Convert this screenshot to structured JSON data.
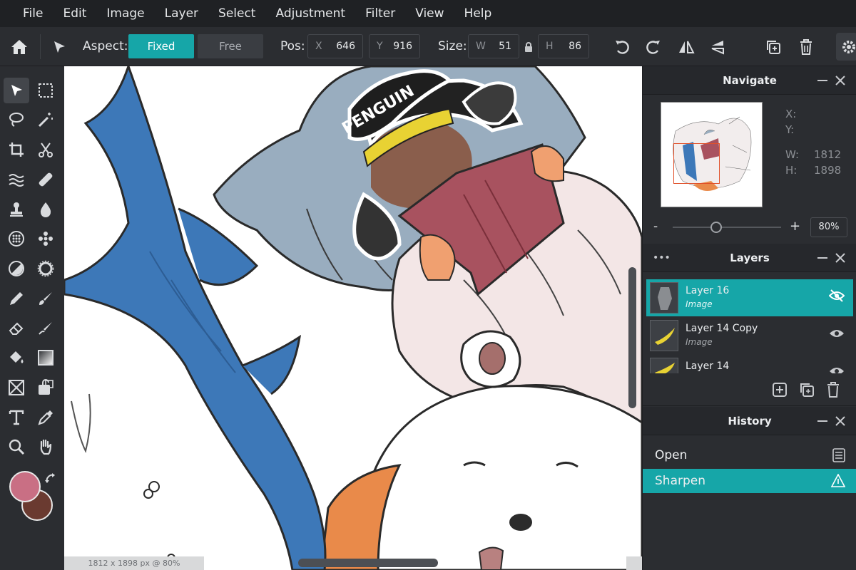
{
  "menu": [
    "File",
    "Edit",
    "Image",
    "Layer",
    "Select",
    "Adjustment",
    "Filter",
    "View",
    "Help"
  ],
  "toolbar": {
    "aspect_label": "Aspect:",
    "fixed_label": "Fixed",
    "free_label": "Free",
    "pos_label": "Pos:",
    "pos_x_key": "X",
    "pos_x": "646",
    "pos_y_key": "Y",
    "pos_y": "916",
    "size_label": "Size:",
    "size_w_key": "W",
    "size_w": "51",
    "size_h_key": "H",
    "size_h": "86"
  },
  "status": {
    "canvas_info": "1812 x 1898 px @ 80%"
  },
  "navigate": {
    "title": "Navigate",
    "x_label": "X:",
    "y_label": "Y:",
    "w_label": "W:",
    "w_value": "1812",
    "h_label": "H:",
    "h_value": "1898",
    "zoom_minus": "-",
    "zoom_plus": "+",
    "zoom_value": "80%",
    "zoom_level": 0.4
  },
  "layers": {
    "title": "Layers",
    "more": "•••",
    "items": [
      {
        "name": "Layer 16",
        "type": "Image",
        "selected": true
      },
      {
        "name": "Layer 14 Copy",
        "type": "Image",
        "selected": false
      },
      {
        "name": "Layer 14",
        "type": "",
        "selected": false
      }
    ]
  },
  "history": {
    "title": "History",
    "items": [
      {
        "label": "Open",
        "selected": false
      },
      {
        "label": "Sharpen",
        "selected": true
      }
    ]
  },
  "colors": {
    "accent": "#16a6a8",
    "primary_swatch": "#c96f84",
    "secondary_swatch": "#6a3a30"
  }
}
